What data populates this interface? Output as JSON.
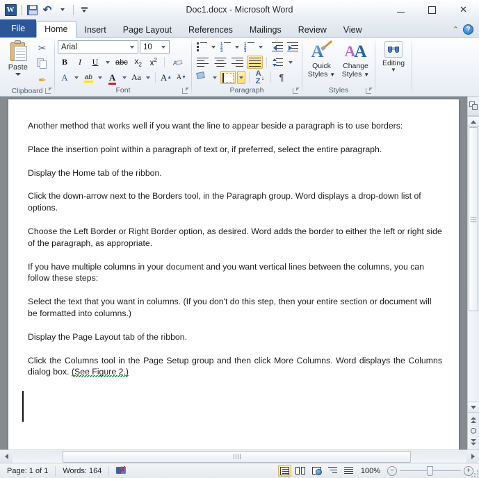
{
  "titlebar": {
    "document_title": "Doc1.docx  -  Microsoft Word",
    "app_logo_letter": "W",
    "qat": [
      {
        "name": "word-logo-icon",
        "label": "W"
      },
      {
        "name": "save-icon",
        "label": "Save"
      },
      {
        "name": "undo-icon",
        "label": "Undo"
      },
      {
        "name": "customize-qat-icon",
        "label": "Customize Quick Access Toolbar"
      }
    ],
    "window_controls": {
      "minimize": "–",
      "maximize": "□",
      "close": "✕"
    }
  },
  "tabs": [
    {
      "label": "File",
      "active": false,
      "kind": "file"
    },
    {
      "label": "Home",
      "active": true,
      "kind": "normal"
    },
    {
      "label": "Insert",
      "active": false,
      "kind": "normal"
    },
    {
      "label": "Page Layout",
      "active": false,
      "kind": "normal"
    },
    {
      "label": "References",
      "active": false,
      "kind": "normal"
    },
    {
      "label": "Mailings",
      "active": false,
      "kind": "normal"
    },
    {
      "label": "Review",
      "active": false,
      "kind": "normal"
    },
    {
      "label": "View",
      "active": false,
      "kind": "normal"
    }
  ],
  "tabrow_right": {
    "minimize_ribbon": "⌃",
    "help": "?"
  },
  "ribbon": {
    "groups": [
      {
        "name": "clipboard",
        "label": "Clipboard",
        "paste_label": "Paste",
        "buttons": [
          "Cut",
          "Copy",
          "Format Painter"
        ]
      },
      {
        "name": "font",
        "label": "Font",
        "font_name": "Arial",
        "font_size": "10",
        "buttons": [
          "Bold",
          "Italic",
          "Underline",
          "Strikethrough",
          "Subscript",
          "Superscript",
          "Clear Formatting",
          "Text Effects",
          "Text Highlight Color",
          "Font Color",
          "Change Case",
          "Grow Font",
          "Shrink Font"
        ],
        "bold_glyph": "B",
        "italic_glyph": "I",
        "underline_glyph": "U",
        "strike_glyph": "abc",
        "sub_glyph": "x",
        "sub_sup": "2",
        "sup_glyph": "x",
        "sup_sup": "2",
        "clear_glyph": "A",
        "effects_glyph": "A",
        "highlight_glyph": "ab",
        "color_glyph": "A",
        "case_glyph": "Aa",
        "grow_glyph": "A",
        "shrink_glyph": "A"
      },
      {
        "name": "paragraph",
        "label": "Paragraph",
        "buttons": [
          "Bullets",
          "Numbering",
          "Multilevel List",
          "Decrease Indent",
          "Increase Indent",
          "Sort",
          "Show/Hide Formatting Marks",
          "Align Text Left",
          "Center",
          "Align Text Right",
          "Justify",
          "Line and Paragraph Spacing",
          "Shading",
          "Borders"
        ],
        "active_buttons": [
          "Justify",
          "Borders"
        ],
        "sort_glyph_a": "A",
        "sort_glyph_z": "Z",
        "pilcrow_glyph": "¶"
      },
      {
        "name": "styles",
        "label": "Styles",
        "quick_styles_line1": "Quick",
        "quick_styles_line2": "Styles",
        "change_styles_line1": "Change",
        "change_styles_line2": "Styles",
        "glyph_A": "A"
      },
      {
        "name": "editing",
        "label": "",
        "editing_label": "Editing"
      }
    ]
  },
  "document": {
    "paragraphs": [
      {
        "text": "Another method that works well if you want the line to appear beside a paragraph is to use borders:",
        "justify": false
      },
      {
        "text": "Place the insertion point within a paragraph of text or, if preferred, select the entire paragraph.",
        "justify": false
      },
      {
        "text": "Display the Home tab of the ribbon.",
        "justify": false
      },
      {
        "text": "Click the down-arrow next to the Borders tool, in the Paragraph group. Word displays a drop-down list of options.",
        "justify": false
      },
      {
        "text": "Choose the Left Border or Right Border option, as desired. Word adds the border to either the left or right side of the paragraph, as appropriate.",
        "justify": false
      },
      {
        "text": "If you have multiple columns in your document and you want vertical lines between the columns, you can follow these steps:",
        "justify": false
      },
      {
        "text": "Select the text that you want in columns. (If you don't do this step, then your entire section or document will be formatted into columns.)",
        "justify": false
      },
      {
        "text": "Display the Page Layout tab of the ribbon.",
        "justify": false
      },
      {
        "text": "Click the Columns tool in the Page Setup group and then click More Columns. Word displays the Columns dialog box. ",
        "justify": true,
        "grammar_marked_tail": "(See Figure 2.)"
      }
    ]
  },
  "vscrollbar": {
    "ruler_toggle": "View Ruler",
    "up_arrow": "▲",
    "down_arrow": "▼",
    "previous_page": "Previous Page",
    "select_browse_object": "Select Browse Object",
    "next_page": "Next Page"
  },
  "hscrollbar": {
    "left_arrow": "◀",
    "right_arrow": "▶"
  },
  "statusbar": {
    "page": "Page: 1 of 1",
    "words": "Words: 164",
    "proofing_icon": "proofing-errors-icon",
    "views": [
      {
        "name": "print-layout",
        "label": "Print Layout",
        "active": true
      },
      {
        "name": "full-screen-reading",
        "label": "Full Screen Reading",
        "active": false
      },
      {
        "name": "web-layout",
        "label": "Web Layout",
        "active": false
      },
      {
        "name": "outline",
        "label": "Outline",
        "active": false
      },
      {
        "name": "draft",
        "label": "Draft",
        "active": false
      }
    ],
    "zoom_level": "100%",
    "zoom_out": "−",
    "zoom_in": "+"
  },
  "colors": {
    "accent_blue": "#2b579a",
    "highlight_orange": "#ffd970",
    "ribbon_bg": "#f0f3f8",
    "doc_bg": "#868b90",
    "grammar_green": "#1e8a3c"
  }
}
